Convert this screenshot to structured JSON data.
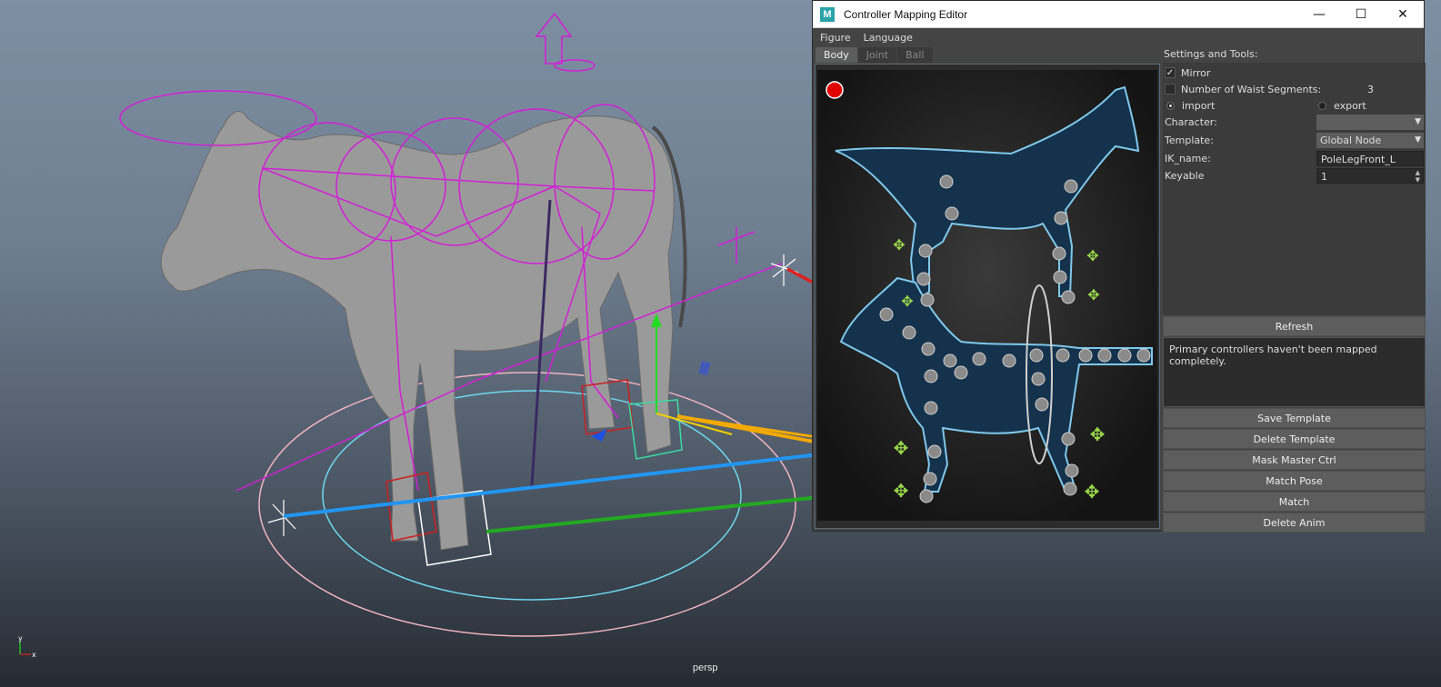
{
  "viewport": {
    "camera_label": "persp"
  },
  "window": {
    "title": "Controller Mapping Editor",
    "app_icon": "M",
    "controls": {
      "minimize": "—",
      "maximize": "☐",
      "close": "✕"
    }
  },
  "menu": {
    "items": [
      "Figure",
      "Language"
    ]
  },
  "tabs": [
    "Body",
    "Joint",
    "Ball"
  ],
  "active_tab": "Body",
  "settings": {
    "heading": "Settings and Tools:",
    "mirror_label": "Mirror",
    "mirror_checked": true,
    "waist_label": "Number of Waist Segments:",
    "waist_value": "3",
    "import_label": "import",
    "export_label": "export",
    "character_label": "Character:",
    "character_value": "",
    "template_label": "Template:",
    "template_value": "Global Node",
    "ik_label": "IK_name:",
    "ik_value": "PoleLegFront_L",
    "keyable_label": "Keyable",
    "keyable_value": "1"
  },
  "buttons": {
    "refresh": "Refresh",
    "save_template": "Save Template",
    "delete_template": "Delete Template",
    "mask_master": "Mask Master Ctrl",
    "match_pose": "Match Pose",
    "match": "Match",
    "delete_anim": "Delete Anim"
  },
  "status_message": "Primary controllers haven't been mapped completely.",
  "colors": {
    "viewport_top": "#7f8fa3",
    "rig_magenta": "#d21fd6",
    "arrow_red": "#e02020",
    "arrow_orange": "#f2a900",
    "arrow_blue": "#2196f3",
    "arrow_green": "#22aa22",
    "figure_fill": "#15324c",
    "figure_outline": "#7fc8ea",
    "plus_green": "#9ad84a"
  }
}
